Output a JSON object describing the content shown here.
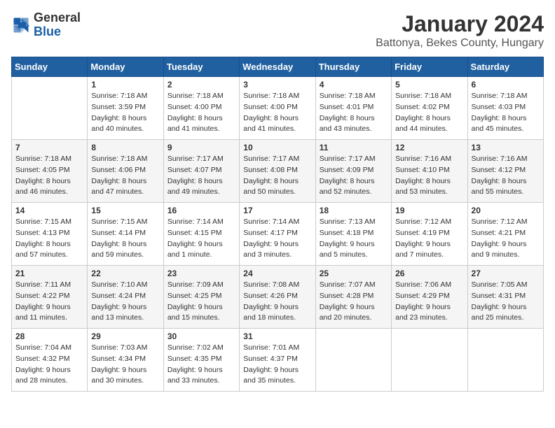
{
  "logo": {
    "general": "General",
    "blue": "Blue"
  },
  "title": "January 2024",
  "location": "Battonya, Bekes County, Hungary",
  "days_of_week": [
    "Sunday",
    "Monday",
    "Tuesday",
    "Wednesday",
    "Thursday",
    "Friday",
    "Saturday"
  ],
  "weeks": [
    [
      {
        "day": "",
        "sunrise": "",
        "sunset": "",
        "daylight": ""
      },
      {
        "day": "1",
        "sunrise": "Sunrise: 7:18 AM",
        "sunset": "Sunset: 3:59 PM",
        "daylight": "Daylight: 8 hours and 40 minutes."
      },
      {
        "day": "2",
        "sunrise": "Sunrise: 7:18 AM",
        "sunset": "Sunset: 4:00 PM",
        "daylight": "Daylight: 8 hours and 41 minutes."
      },
      {
        "day": "3",
        "sunrise": "Sunrise: 7:18 AM",
        "sunset": "Sunset: 4:00 PM",
        "daylight": "Daylight: 8 hours and 41 minutes."
      },
      {
        "day": "4",
        "sunrise": "Sunrise: 7:18 AM",
        "sunset": "Sunset: 4:01 PM",
        "daylight": "Daylight: 8 hours and 43 minutes."
      },
      {
        "day": "5",
        "sunrise": "Sunrise: 7:18 AM",
        "sunset": "Sunset: 4:02 PM",
        "daylight": "Daylight: 8 hours and 44 minutes."
      },
      {
        "day": "6",
        "sunrise": "Sunrise: 7:18 AM",
        "sunset": "Sunset: 4:03 PM",
        "daylight": "Daylight: 8 hours and 45 minutes."
      }
    ],
    [
      {
        "day": "7",
        "sunrise": "Sunrise: 7:18 AM",
        "sunset": "Sunset: 4:05 PM",
        "daylight": "Daylight: 8 hours and 46 minutes."
      },
      {
        "day": "8",
        "sunrise": "Sunrise: 7:18 AM",
        "sunset": "Sunset: 4:06 PM",
        "daylight": "Daylight: 8 hours and 47 minutes."
      },
      {
        "day": "9",
        "sunrise": "Sunrise: 7:17 AM",
        "sunset": "Sunset: 4:07 PM",
        "daylight": "Daylight: 8 hours and 49 minutes."
      },
      {
        "day": "10",
        "sunrise": "Sunrise: 7:17 AM",
        "sunset": "Sunset: 4:08 PM",
        "daylight": "Daylight: 8 hours and 50 minutes."
      },
      {
        "day": "11",
        "sunrise": "Sunrise: 7:17 AM",
        "sunset": "Sunset: 4:09 PM",
        "daylight": "Daylight: 8 hours and 52 minutes."
      },
      {
        "day": "12",
        "sunrise": "Sunrise: 7:16 AM",
        "sunset": "Sunset: 4:10 PM",
        "daylight": "Daylight: 8 hours and 53 minutes."
      },
      {
        "day": "13",
        "sunrise": "Sunrise: 7:16 AM",
        "sunset": "Sunset: 4:12 PM",
        "daylight": "Daylight: 8 hours and 55 minutes."
      }
    ],
    [
      {
        "day": "14",
        "sunrise": "Sunrise: 7:15 AM",
        "sunset": "Sunset: 4:13 PM",
        "daylight": "Daylight: 8 hours and 57 minutes."
      },
      {
        "day": "15",
        "sunrise": "Sunrise: 7:15 AM",
        "sunset": "Sunset: 4:14 PM",
        "daylight": "Daylight: 8 hours and 59 minutes."
      },
      {
        "day": "16",
        "sunrise": "Sunrise: 7:14 AM",
        "sunset": "Sunset: 4:15 PM",
        "daylight": "Daylight: 9 hours and 1 minute."
      },
      {
        "day": "17",
        "sunrise": "Sunrise: 7:14 AM",
        "sunset": "Sunset: 4:17 PM",
        "daylight": "Daylight: 9 hours and 3 minutes."
      },
      {
        "day": "18",
        "sunrise": "Sunrise: 7:13 AM",
        "sunset": "Sunset: 4:18 PM",
        "daylight": "Daylight: 9 hours and 5 minutes."
      },
      {
        "day": "19",
        "sunrise": "Sunrise: 7:12 AM",
        "sunset": "Sunset: 4:19 PM",
        "daylight": "Daylight: 9 hours and 7 minutes."
      },
      {
        "day": "20",
        "sunrise": "Sunrise: 7:12 AM",
        "sunset": "Sunset: 4:21 PM",
        "daylight": "Daylight: 9 hours and 9 minutes."
      }
    ],
    [
      {
        "day": "21",
        "sunrise": "Sunrise: 7:11 AM",
        "sunset": "Sunset: 4:22 PM",
        "daylight": "Daylight: 9 hours and 11 minutes."
      },
      {
        "day": "22",
        "sunrise": "Sunrise: 7:10 AM",
        "sunset": "Sunset: 4:24 PM",
        "daylight": "Daylight: 9 hours and 13 minutes."
      },
      {
        "day": "23",
        "sunrise": "Sunrise: 7:09 AM",
        "sunset": "Sunset: 4:25 PM",
        "daylight": "Daylight: 9 hours and 15 minutes."
      },
      {
        "day": "24",
        "sunrise": "Sunrise: 7:08 AM",
        "sunset": "Sunset: 4:26 PM",
        "daylight": "Daylight: 9 hours and 18 minutes."
      },
      {
        "day": "25",
        "sunrise": "Sunrise: 7:07 AM",
        "sunset": "Sunset: 4:28 PM",
        "daylight": "Daylight: 9 hours and 20 minutes."
      },
      {
        "day": "26",
        "sunrise": "Sunrise: 7:06 AM",
        "sunset": "Sunset: 4:29 PM",
        "daylight": "Daylight: 9 hours and 23 minutes."
      },
      {
        "day": "27",
        "sunrise": "Sunrise: 7:05 AM",
        "sunset": "Sunset: 4:31 PM",
        "daylight": "Daylight: 9 hours and 25 minutes."
      }
    ],
    [
      {
        "day": "28",
        "sunrise": "Sunrise: 7:04 AM",
        "sunset": "Sunset: 4:32 PM",
        "daylight": "Daylight: 9 hours and 28 minutes."
      },
      {
        "day": "29",
        "sunrise": "Sunrise: 7:03 AM",
        "sunset": "Sunset: 4:34 PM",
        "daylight": "Daylight: 9 hours and 30 minutes."
      },
      {
        "day": "30",
        "sunrise": "Sunrise: 7:02 AM",
        "sunset": "Sunset: 4:35 PM",
        "daylight": "Daylight: 9 hours and 33 minutes."
      },
      {
        "day": "31",
        "sunrise": "Sunrise: 7:01 AM",
        "sunset": "Sunset: 4:37 PM",
        "daylight": "Daylight: 9 hours and 35 minutes."
      },
      {
        "day": "",
        "sunrise": "",
        "sunset": "",
        "daylight": ""
      },
      {
        "day": "",
        "sunrise": "",
        "sunset": "",
        "daylight": ""
      },
      {
        "day": "",
        "sunrise": "",
        "sunset": "",
        "daylight": ""
      }
    ]
  ]
}
